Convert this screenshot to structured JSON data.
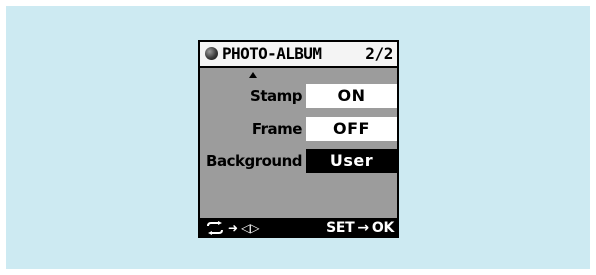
{
  "screen": {
    "title": "PHOTO-ALBUM",
    "page": "2/2"
  },
  "rows": [
    {
      "label": "Stamp",
      "value": "ON",
      "selected": false
    },
    {
      "label": "Frame",
      "value": "OFF",
      "selected": false
    },
    {
      "label": "Background",
      "value": "User",
      "selected": true
    }
  ],
  "footer": {
    "left_icons": [
      "swap-icon",
      "arrow-right-icon",
      "left-right-arrows-icon"
    ],
    "right_label": "SET",
    "right_arrow": "→",
    "right_action": "OK"
  },
  "colors": {
    "backdrop": "#cdeaf2",
    "panel": "#9c9c9c",
    "title_bar": "#f4f4f4",
    "selected": "#000000"
  }
}
